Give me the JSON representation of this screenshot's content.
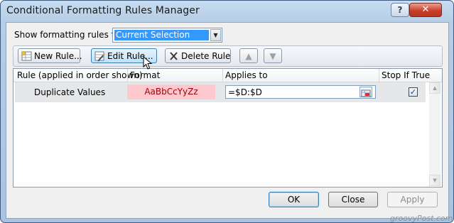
{
  "window": {
    "title": "Conditional Formatting Rules Manager",
    "help_label": "?",
    "close_label": "✕"
  },
  "scope": {
    "label": "Show formatting rules for:",
    "selected": "Current Selection"
  },
  "toolbar": {
    "new_rule_label": "New Rule...",
    "edit_rule_label": "Edit Rule...",
    "delete_rule_label": "Delete Rule",
    "move_up_glyph": "▲",
    "move_down_glyph": "▼"
  },
  "grid": {
    "columns": [
      "Rule (applied in order shown)",
      "Format",
      "Applies to",
      "Stop If True"
    ],
    "rows": [
      {
        "rule": "Duplicate Values",
        "format_preview": "AaBbCcYyZz",
        "applies_to": "=$D:$D",
        "stop_if_true": true,
        "check_glyph": "✓"
      }
    ]
  },
  "footer": {
    "ok_label": "OK",
    "close_label": "Close",
    "apply_label": "Apply"
  },
  "watermark": "groovyPost.com",
  "colors": {
    "format_fill": "#ffc7ce",
    "format_text": "#9c0006",
    "selection": "#3399ff"
  },
  "icons": [
    "new-rule-icon",
    "edit-rule-icon",
    "delete-x-icon",
    "move-up-icon",
    "move-down-icon",
    "range-select-icon",
    "dropdown-arrow-icon",
    "mouse-cursor-icon"
  ]
}
